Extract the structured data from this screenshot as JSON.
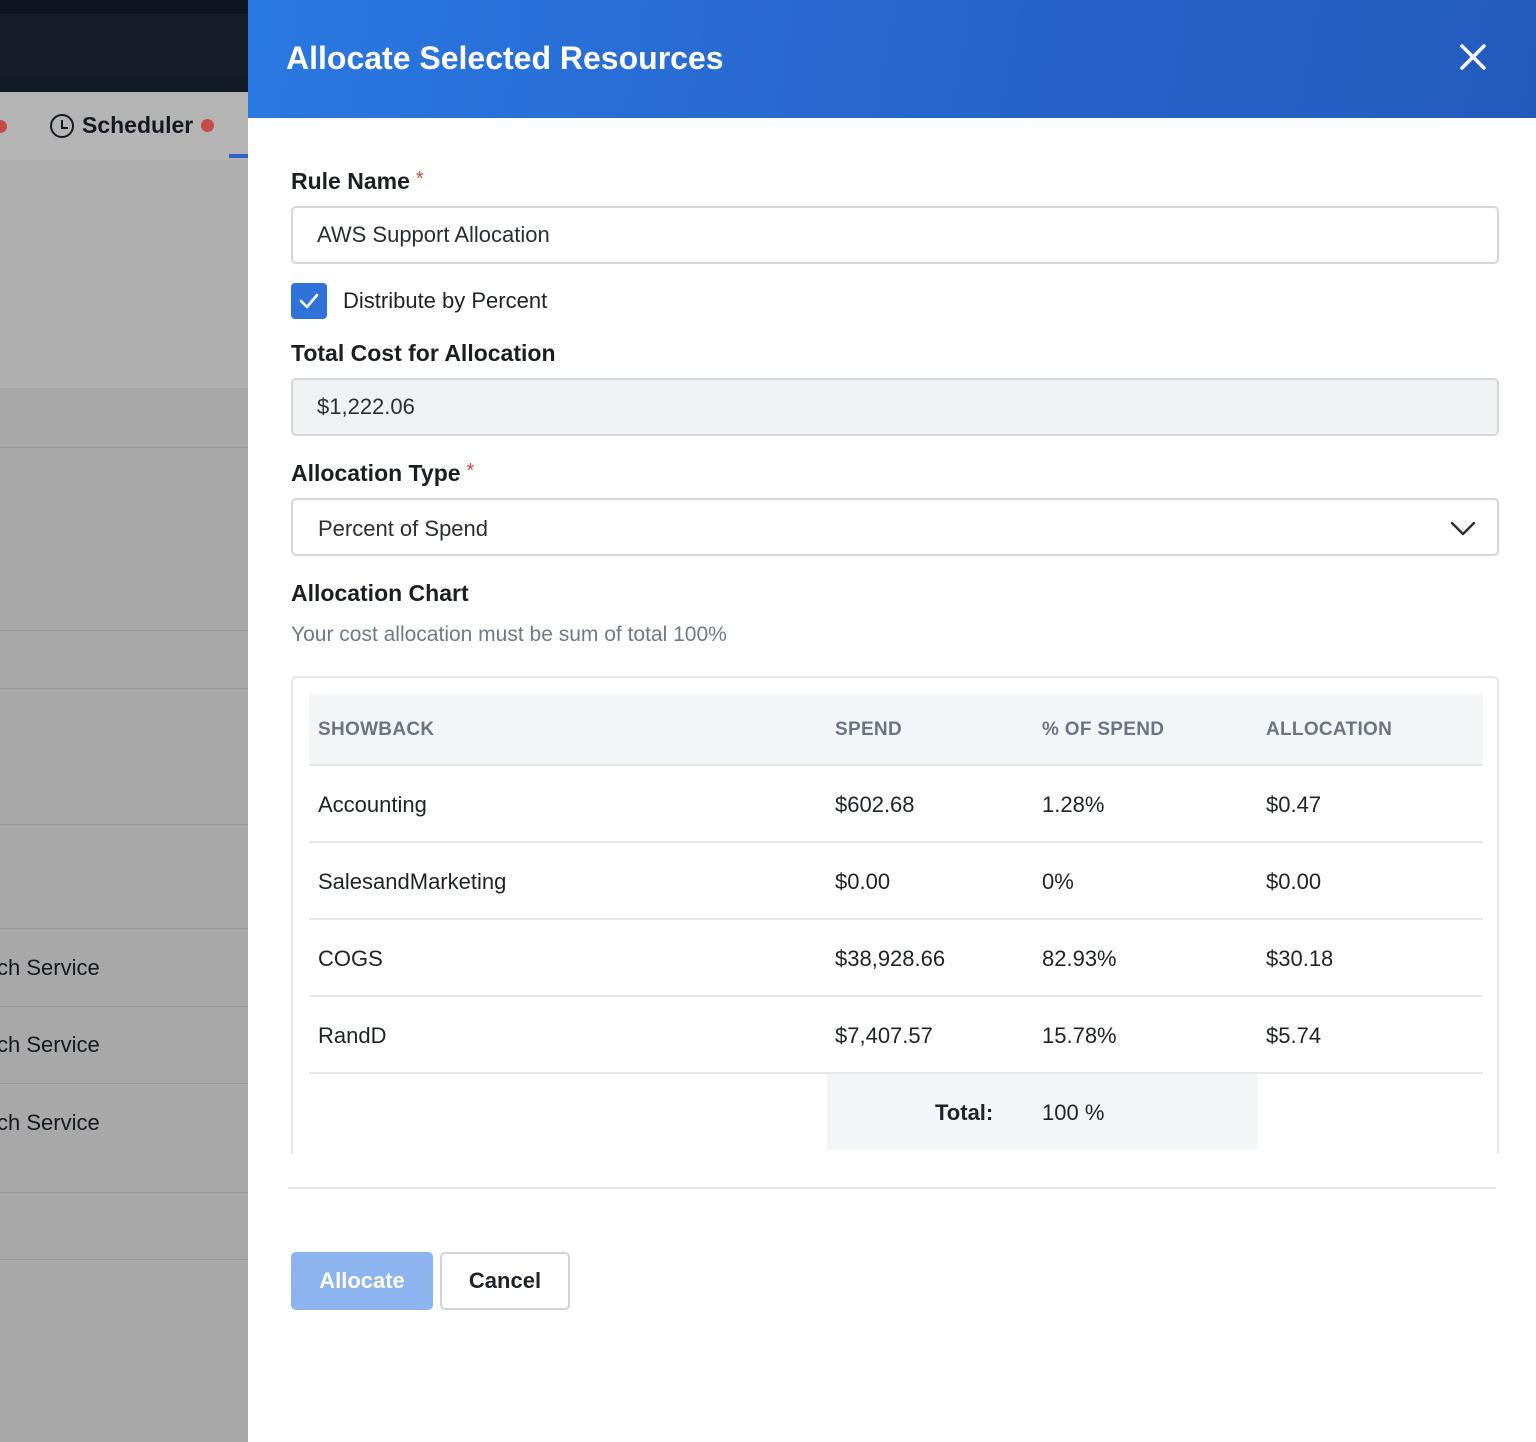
{
  "background": {
    "tab_label": "Scheduler",
    "rows": [
      "ch Service",
      "ch Service",
      "ch Service"
    ]
  },
  "modal": {
    "title": "Allocate Selected Resources",
    "rule_name": {
      "label": "Rule Name",
      "required_mark": "*",
      "value": "AWS Support Allocation"
    },
    "distribute_checkbox": {
      "label": "Distribute by Percent",
      "checked": true
    },
    "total_cost": {
      "label": "Total Cost for Allocation",
      "value": "$1,222.06"
    },
    "allocation_type": {
      "label": "Allocation Type",
      "required_mark": "*",
      "selected": "Percent of Spend"
    },
    "chart": {
      "label": "Allocation Chart",
      "hint": "Your cost allocation must be sum of total 100%",
      "columns": [
        "SHOWBACK",
        "SPEND",
        "% OF SPEND",
        "ALLOCATION"
      ],
      "rows": [
        {
          "showback": "Accounting",
          "spend": "$602.68",
          "pct": "1.28%",
          "allocation": "$0.47"
        },
        {
          "showback": "SalesandMarketing",
          "spend": "$0.00",
          "pct": "0%",
          "allocation": "$0.00"
        },
        {
          "showback": "COGS",
          "spend": "$38,928.66",
          "pct": "82.93%",
          "allocation": "$30.18"
        },
        {
          "showback": "RandD",
          "spend": "$7,407.57",
          "pct": "15.78%",
          "allocation": "$5.74"
        }
      ],
      "total_label": "Total:",
      "total_value": "100 %"
    },
    "buttons": {
      "allocate": "Allocate",
      "cancel": "Cancel"
    }
  },
  "colors": {
    "header_blue": "#2663c9",
    "checkbox_blue": "#2f73d9",
    "allocate_disabled": "#8cb4ef",
    "required_red": "#e0443d",
    "status_dot": "#c44b47"
  }
}
